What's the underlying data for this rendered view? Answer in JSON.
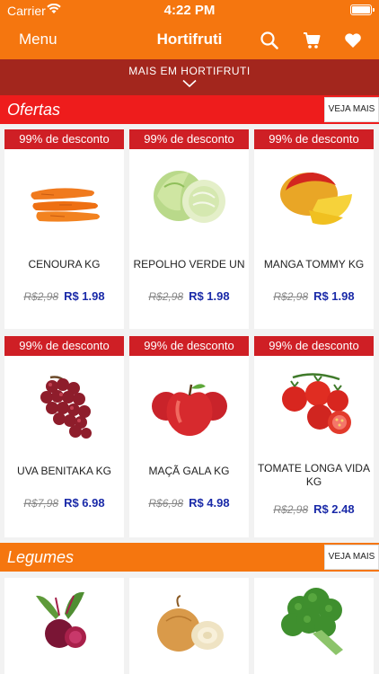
{
  "status_bar": {
    "carrier": "Carrier",
    "time": "4:22 PM"
  },
  "nav": {
    "menu_label": "Menu",
    "title": "Hortifruti"
  },
  "subheader": {
    "label": "MAIS EM HORTIFRUTI"
  },
  "sections": [
    {
      "title": "Ofertas",
      "button": "VEJA MAIS",
      "color": "#ee1c1c"
    },
    {
      "title": "Legumes",
      "button": "VEJA MAIS",
      "color": "#f5760f"
    }
  ],
  "offers": [
    {
      "badge": "99% de desconto",
      "name": "CENOURA KG",
      "old_price": "R$2,98",
      "price": "R$ 1.98",
      "icon": "carrot-icon"
    },
    {
      "badge": "99% de desconto",
      "name": "REPOLHO VERDE UN",
      "old_price": "R$2,98",
      "price": "R$ 1.98",
      "icon": "cabbage-icon"
    },
    {
      "badge": "99% de desconto",
      "name": "MANGA TOMMY KG",
      "old_price": "R$2,98",
      "price": "R$ 1.98",
      "icon": "mango-icon"
    },
    {
      "badge": "99% de desconto",
      "name": "UVA BENITAKA KG",
      "old_price": "R$7,98",
      "price": "R$ 6.98",
      "icon": "grapes-icon"
    },
    {
      "badge": "99% de desconto",
      "name": "MAÇÃ GALA KG",
      "old_price": "R$6,98",
      "price": "R$ 4.98",
      "icon": "apple-icon"
    },
    {
      "badge": "99% de desconto",
      "name": "TOMATE LONGA VIDA KG",
      "old_price": "R$2,98",
      "price": "R$ 2.48",
      "icon": "tomato-icon"
    }
  ],
  "legumes_icons": [
    "beet-icon",
    "onion-icon",
    "broccoli-icon"
  ],
  "colors": {
    "brand_orange": "#f5760f",
    "dark_red": "#a3261d",
    "badge_red": "#cf1f25",
    "price_blue": "#1a2aa8"
  }
}
